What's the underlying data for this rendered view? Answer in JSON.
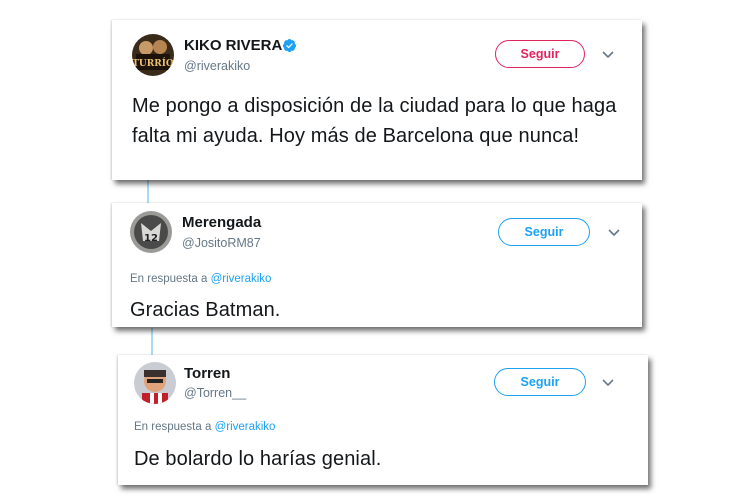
{
  "tweets": [
    {
      "name": "KIKO RIVERA",
      "handle": "@riverakiko",
      "follow_label": "Seguir",
      "text": "Me pongo a disposición de la ciudad para lo que haga falta mi ayuda. Hoy más de Barcelona que nunca!",
      "avatar_text": "TURRÍO"
    },
    {
      "name": "Merengada",
      "handle": "@JositoRM87",
      "follow_label": "Seguir",
      "reply_prefix": "En respuesta a",
      "reply_mention": "@riverakiko",
      "text": "Gracias Batman.",
      "avatar_text": "12"
    },
    {
      "name": "Torren",
      "handle": "@Torren__",
      "follow_label": "Seguir",
      "reply_prefix": "En respuesta a",
      "reply_mention": "@riverakiko",
      "text": "De bolardo lo harías genial."
    }
  ],
  "colors": {
    "verified": "#1da1f2",
    "follow_red": "#e0245e",
    "follow_blue": "#1da1f2",
    "secondary_text": "#657786",
    "thread_line": "#a9dcf3"
  },
  "icons": [
    "verified-badge-icon",
    "chevron-down-icon"
  ]
}
